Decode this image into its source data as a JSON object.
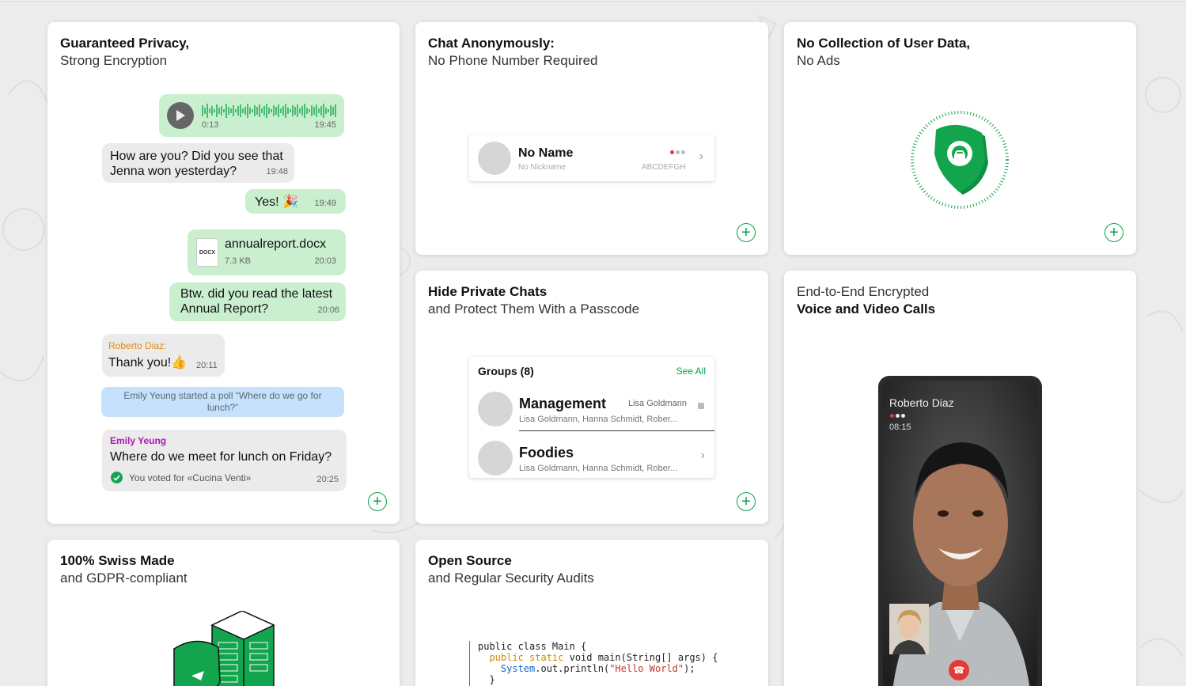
{
  "cards": {
    "privacy": {
      "title1": "Guaranteed Privacy,",
      "title2": "Strong Encryption",
      "voice": {
        "duration": "0:13",
        "time": "19:45"
      },
      "msg1": {
        "line1": "How are you? Did you see that",
        "line2": "Jenna won yesterday?",
        "time": "19:48"
      },
      "msg2": {
        "text": "Yes! 🎉",
        "time": "19:49"
      },
      "file": {
        "icon_text": "DOCX",
        "name": "annualreport.docx",
        "size": "7.3 KB",
        "time": "20:03"
      },
      "msg3": {
        "line1": "Btw. did you read the latest",
        "line2": "Annual Report?",
        "time": "20:06"
      },
      "msg4": {
        "sender": "Roberto Diaz:",
        "text": "Thank you!👍",
        "time": "20:11"
      },
      "poll_notice": "Emily Yeung started a poll “Where do we go for lunch?”",
      "msg5": {
        "sender": "Emily Yeung",
        "text": "Where do we meet for lunch on Friday?",
        "vote": "You voted for «Cucina Venti»",
        "time": "20:25"
      }
    },
    "anonymous": {
      "title1": "Chat Anonymously:",
      "title2": "No Phone Number Required",
      "contact": {
        "name": "No Name",
        "nickname": "No Nickname",
        "id": "ABCDEFGH"
      }
    },
    "nodata": {
      "title1": "No Collection of User Data,",
      "title2": "No Ads"
    },
    "hide": {
      "title1": "Hide Private Chats",
      "title2": "and Protect Them With a Passcode",
      "groups_header": "Groups (8)",
      "see_all": "See All",
      "groups": [
        {
          "name": "Management",
          "members": "Lisa Goldmann, Hanna Schmidt, Rober...",
          "last": "Lisa Goldmann"
        },
        {
          "name": "Foodies",
          "members": "Lisa Goldmann, Hanna Schmidt, Rober..."
        }
      ]
    },
    "calls": {
      "title1": "End-to-End Encrypted",
      "title2": "Voice and Video Calls",
      "caller": "Roberto Diaz",
      "duration": "08:15"
    },
    "swiss": {
      "title1": "100% Swiss Made",
      "title2": "and GDPR-compliant"
    },
    "opensource": {
      "title1": "Open Source",
      "title2": "and Regular Security Audits",
      "code": {
        "l1": "public class Main {",
        "l2a": "public static",
        "l2b": " void main(String[] args) {",
        "l3a": "System",
        "l3b": ".out.println(",
        "l3c": "\"Hello World\"",
        "l3d": ");",
        "l4": "}"
      }
    }
  },
  "colors": {
    "accent": "#0aa14a",
    "bubble_out": "#c9efcf",
    "bubble_in": "#ebebeb"
  }
}
